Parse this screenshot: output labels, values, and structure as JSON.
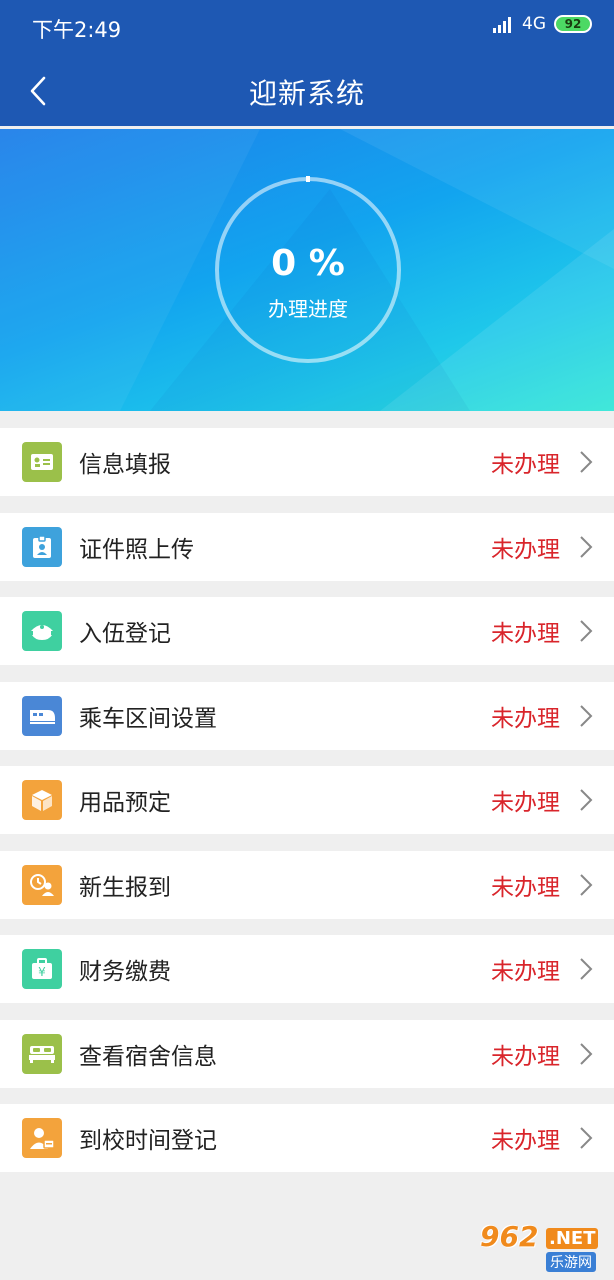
{
  "status_bar": {
    "time": "下午2:49",
    "network": "4G",
    "battery": "92"
  },
  "header": {
    "title": "迎新系统"
  },
  "progress": {
    "value_text": "0 %",
    "caption": "办理进度",
    "fraction": 0
  },
  "items": [
    {
      "label": "信息填报",
      "status": "未办理",
      "icon": "id-card-icon",
      "color": "#9bc04a"
    },
    {
      "label": "证件照上传",
      "status": "未办理",
      "icon": "badge-photo-icon",
      "color": "#3ea2dc"
    },
    {
      "label": "入伍登记",
      "status": "未办理",
      "icon": "military-cap-icon",
      "color": "#3fd0a0"
    },
    {
      "label": "乘车区间设置",
      "status": "未办理",
      "icon": "train-icon",
      "color": "#4a87d6"
    },
    {
      "label": "用品预定",
      "status": "未办理",
      "icon": "package-box-icon",
      "color": "#f3a33c"
    },
    {
      "label": "新生报到",
      "status": "未办理",
      "icon": "clock-user-icon",
      "color": "#f3a33c"
    },
    {
      "label": "财务缴费",
      "status": "未办理",
      "icon": "wallet-yuan-icon",
      "color": "#3fd0a0"
    },
    {
      "label": "查看宿舍信息",
      "status": "未办理",
      "icon": "bed-icon",
      "color": "#9bc04a"
    },
    {
      "label": "到校时间登记",
      "status": "未办理",
      "icon": "user-card-icon",
      "color": "#f3a33c"
    }
  ],
  "watermark": {
    "brand": "962",
    "suffix": ".NET",
    "subtitle": "乐游网"
  }
}
